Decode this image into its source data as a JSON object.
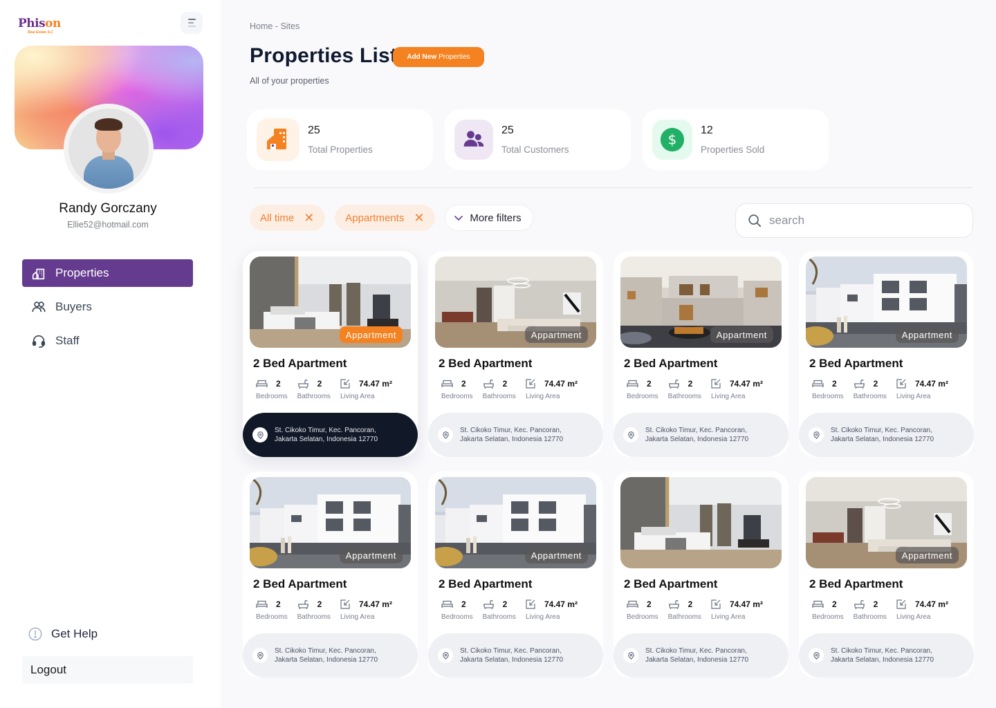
{
  "brand": {
    "name_part1": "Phis",
    "name_part2": "on",
    "tagline": "Real Estate S.C"
  },
  "user": {
    "name": "Randy Gorczany",
    "email": "Ellie52@hotmail.com"
  },
  "sidebar": {
    "items": [
      {
        "label": "Properties",
        "icon": "building-icon",
        "active": true
      },
      {
        "label": "Buyers",
        "icon": "users-icon",
        "active": false
      },
      {
        "label": "Staff",
        "icon": "headset-icon",
        "active": false
      }
    ],
    "help_label": "Get Help",
    "logout_label": "Logout"
  },
  "header": {
    "breadcrumb": "Home -  Sites",
    "title_light": "Properties ",
    "title_bold": "List",
    "add_button_bold": "Add New",
    "add_button_rest": "Properties",
    "subtitle": "All of  your properties"
  },
  "stats": [
    {
      "value": "25",
      "label": "Total Properties",
      "icon": "building-icon"
    },
    {
      "value": "25",
      "label": "Total Customers",
      "icon": "customers-icon"
    },
    {
      "value": "12",
      "label": "Properties Sold",
      "icon": "dollar-icon"
    }
  ],
  "filters": {
    "chips": [
      "All time",
      "Appartments"
    ],
    "more_label": "More filters",
    "search_placeholder": "search"
  },
  "colors": {
    "accent": "#f58220",
    "primary": "#653b8f",
    "dark": "#111827",
    "success": "#22b066"
  },
  "properties": [
    {
      "title": "2 Bed Apartment",
      "badge": "Appartment",
      "photo": "bedroom",
      "bedrooms": "2",
      "bathrooms": "2",
      "area": "74.47 m²",
      "bedrooms_label": "Bedrooms",
      "bathrooms_label": "Bathrooms",
      "area_label": "Living Area",
      "address": "St. Cikoko Timur, Kec. Pancoran, Jakarta Selatan, Indonesia 12770",
      "selected": true
    },
    {
      "title": "2 Bed Apartment",
      "badge": "Appartment",
      "photo": "living",
      "bedrooms": "2",
      "bathrooms": "2",
      "area": "74.47 m²",
      "bedrooms_label": "Bedrooms",
      "bathrooms_label": "Bathrooms",
      "area_label": "Living Area",
      "address": "St. Cikoko Timur, Kec. Pancoran, Jakarta Selatan, Indonesia 12770",
      "selected": false
    },
    {
      "title": "2 Bed Apartment",
      "badge": "Appartment",
      "photo": "house",
      "bedrooms": "2",
      "bathrooms": "2",
      "area": "74.47 m²",
      "bedrooms_label": "Bedrooms",
      "bathrooms_label": "Bathrooms",
      "area_label": "Living Area",
      "address": "St. Cikoko Timur, Kec. Pancoran, Jakarta Selatan, Indonesia 12770",
      "selected": false
    },
    {
      "title": "2 Bed Apartment",
      "badge": "Appartment",
      "photo": "townhouse",
      "bedrooms": "2",
      "bathrooms": "2",
      "area": "74.47 m²",
      "bedrooms_label": "Bedrooms",
      "bathrooms_label": "Bathrooms",
      "area_label": "Living Area",
      "address": "St. Cikoko Timur, Kec. Pancoran, Jakarta Selatan, Indonesia 12770",
      "selected": false
    },
    {
      "title": "2 Bed Apartment",
      "badge": "Appartment",
      "photo": "townhouse",
      "bedrooms": "2",
      "bathrooms": "2",
      "area": "74.47 m²",
      "bedrooms_label": "Bedrooms",
      "bathrooms_label": "Bathrooms",
      "area_label": "Living Area",
      "address": "St. Cikoko Timur, Kec. Pancoran, Jakarta Selatan, Indonesia 12770",
      "selected": false
    },
    {
      "title": "2 Bed Apartment",
      "badge": "Appartment",
      "photo": "townhouse",
      "bedrooms": "2",
      "bathrooms": "2",
      "area": "74.47 m²",
      "bedrooms_label": "Bedrooms",
      "bathrooms_label": "Bathrooms",
      "area_label": "Living Area",
      "address": "St. Cikoko Timur, Kec. Pancoran, Jakarta Selatan, Indonesia 12770",
      "selected": false
    },
    {
      "title": "2 Bed Apartment",
      "badge": "",
      "photo": "bedroom",
      "bedrooms": "2",
      "bathrooms": "2",
      "area": "74.47 m²",
      "bedrooms_label": "Bedrooms",
      "bathrooms_label": "Bathrooms",
      "area_label": "Living Area",
      "address": "St. Cikoko Timur, Kec. Pancoran, Jakarta Selatan, Indonesia 12770",
      "selected": false
    },
    {
      "title": "2 Bed Apartment",
      "badge": "Appartment",
      "photo": "living",
      "bedrooms": "2",
      "bathrooms": "2",
      "area": "74.47 m²",
      "bedrooms_label": "Bedrooms",
      "bathrooms_label": "Bathrooms",
      "area_label": "Living Area",
      "address": "St. Cikoko Timur, Kec. Pancoran, Jakarta Selatan, Indonesia 12770",
      "selected": false
    }
  ]
}
